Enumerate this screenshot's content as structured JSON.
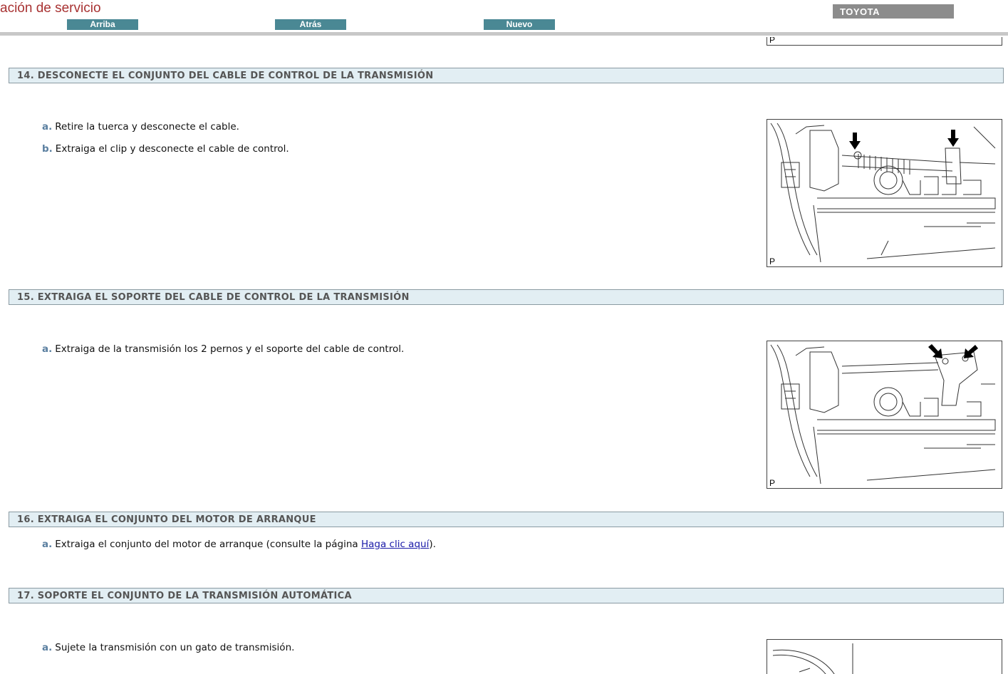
{
  "header": {
    "app_title": "ación de servicio",
    "nav": {
      "up_label": "Arriba",
      "back_label": "Atrás",
      "new_label": "Nuevo"
    },
    "brand": "TOYOTA"
  },
  "figure_label": "P",
  "sections": [
    {
      "heading": "14. DESCONECTE EL CONJUNTO DEL CABLE DE CONTROL DE LA TRANSMISIÓN",
      "steps": [
        {
          "marker": "a.",
          "text": "Retire la tuerca y desconecte el cable."
        },
        {
          "marker": "b.",
          "text": "Extraiga el clip y desconecte el cable de control."
        }
      ]
    },
    {
      "heading": "15. EXTRAIGA EL SOPORTE DEL CABLE DE CONTROL DE LA TRANSMISIÓN",
      "steps": [
        {
          "marker": "a.",
          "text": "Extraiga de la transmisión los 2 pernos y el soporte del cable de control."
        }
      ]
    },
    {
      "heading": "16. EXTRAIGA EL CONJUNTO DEL MOTOR DE ARRANQUE",
      "steps": [
        {
          "marker": "a.",
          "text_before": "Extraiga el conjunto del motor de arranque (consulte la página ",
          "link": "Haga clic aquí",
          "text_after": ")."
        }
      ]
    },
    {
      "heading": "17. SOPORTE EL CONJUNTO DE LA TRANSMISIÓN AUTOMÁTICA",
      "steps": [
        {
          "marker": "a.",
          "text": "Sujete la transmisión con un gato de transmisión."
        }
      ]
    }
  ]
}
